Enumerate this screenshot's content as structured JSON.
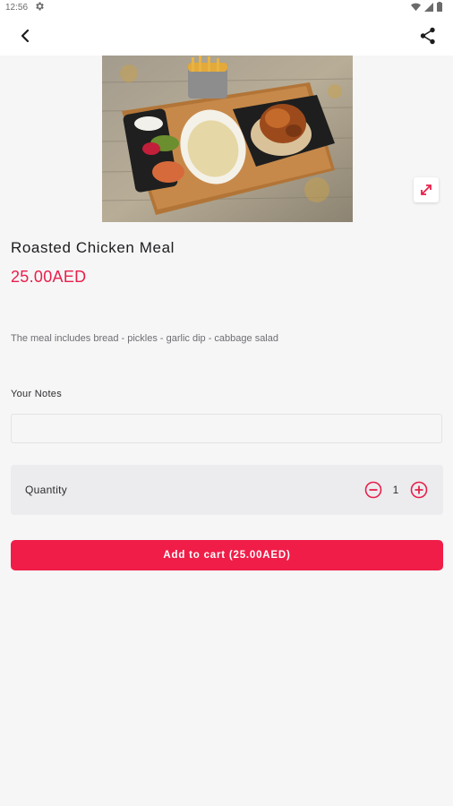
{
  "status_bar": {
    "time": "12:56",
    "icons": [
      "gear-icon",
      "wifi-icon",
      "signal-icon",
      "battery-icon"
    ]
  },
  "app_bar": {
    "back_icon": "back-arrow-icon",
    "share_icon": "share-icon"
  },
  "product": {
    "image_alt": "Roasted chicken meal platter",
    "title": "Roasted Chicken Meal",
    "price": "25.00AED",
    "description": "The meal includes bread - pickles - garlic dip - cabbage salad"
  },
  "notes": {
    "label": "Your Notes",
    "placeholder": "",
    "value": ""
  },
  "quantity": {
    "label": "Quantity",
    "value": "1"
  },
  "cta": {
    "label": "Add to cart (25.00AED)"
  },
  "colors": {
    "accent": "#f01d48",
    "price": "#e8204b",
    "background": "#f6f6f7"
  }
}
